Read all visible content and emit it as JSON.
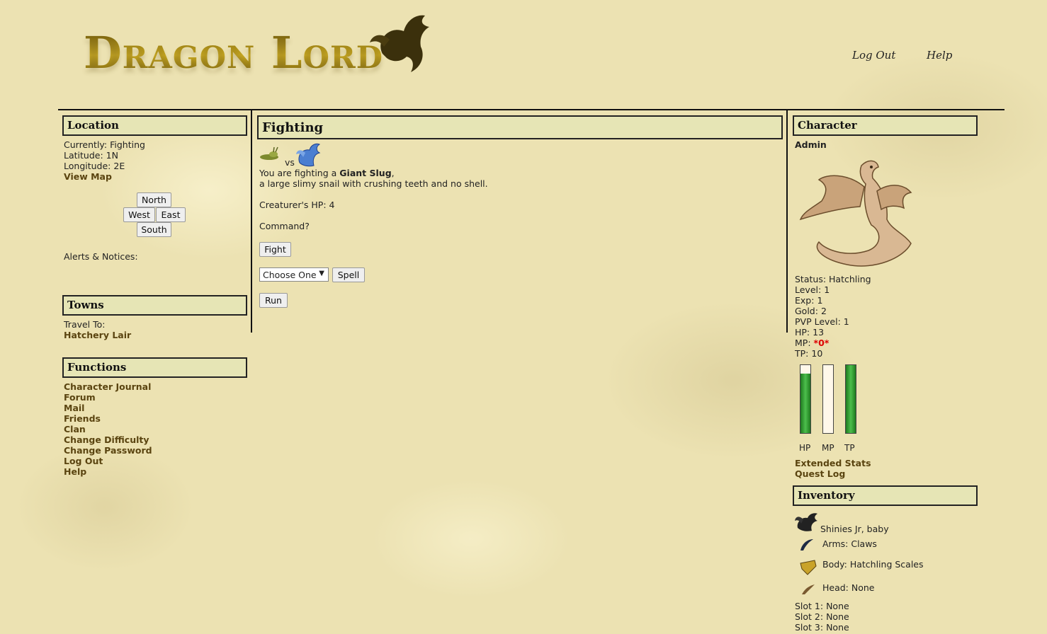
{
  "header": {
    "logo_text": "Dragon Lord",
    "logout_label": "Log Out",
    "help_label": "Help"
  },
  "location": {
    "title": "Location",
    "currently_label": "Currently:",
    "currently_value": "Fighting",
    "latitude_label": "Latitude:",
    "latitude_value": "1N",
    "longitude_label": "Longitude:",
    "longitude_value": "2E",
    "view_map": "View Map",
    "north": "North",
    "west": "West",
    "east": "East",
    "south": "South",
    "alerts": "Alerts & Notices:"
  },
  "towns": {
    "title": "Towns",
    "travel_to": "Travel To:",
    "town": "Hatchery Lair"
  },
  "functions": {
    "title": "Functions",
    "items": [
      "Character Journal",
      "Forum",
      "Mail",
      "Friends",
      "Clan",
      "Change Difficulty",
      "Change Password",
      "Log Out",
      "Help"
    ]
  },
  "fighting": {
    "title": "Fighting",
    "vs": "vs",
    "intro": "You are fighting a",
    "monster": "Giant Slug",
    "comma": ",",
    "description": "a large slimy snail with crushing teeth and no shell.",
    "hp_line": "Creaturer's HP: 4",
    "command": "Command?",
    "fight_btn": "Fight",
    "spell_select": "Choose One",
    "spell_btn": "Spell",
    "run_btn": "Run"
  },
  "character": {
    "title": "Character",
    "name": "Admin",
    "stats": {
      "status_label": "Status:",
      "status": "Hatchling",
      "level_label": "Level:",
      "level": "1",
      "exp_label": "Exp:",
      "exp": "1",
      "gold_label": "Gold:",
      "gold": "2",
      "pvp_label": "PVP Level:",
      "pvp": "1",
      "hp_label": "HP:",
      "hp": "13",
      "mp_label": "MP:",
      "mp": "*0*",
      "tp_label": "TP:",
      "tp": "10"
    },
    "bars": [
      {
        "label": "HP",
        "fill_fraction": 0.88
      },
      {
        "label": "MP",
        "fill_fraction": 0.0
      },
      {
        "label": "TP",
        "fill_fraction": 1.0
      }
    ],
    "extended_stats": "Extended Stats",
    "quest_log": "Quest Log",
    "mp_color": "#dd0000",
    "bar_color": "#2e9a2e"
  },
  "inventory": {
    "title": "Inventory",
    "pet": "Shinies Jr, baby",
    "arms": "Arms: Claws",
    "body": "Body: Hatchling Scales",
    "head": "Head: None",
    "slots": [
      "Slot 1: None",
      "Slot 2: None",
      "Slot 3: None"
    ]
  }
}
